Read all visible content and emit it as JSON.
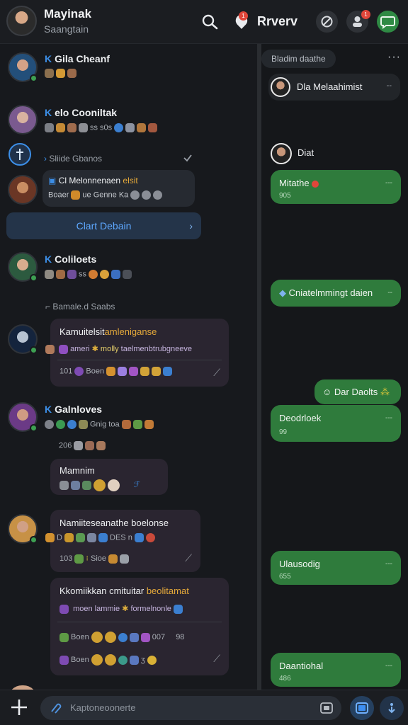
{
  "header": {
    "name": "Mayinak",
    "subtitle": "Saangtain",
    "brand": "Rrverv",
    "pin_badge": "1",
    "notif_badge": "1"
  },
  "chats": [
    {
      "name": "Gila Cheanf",
      "prefix": "K",
      "meta": ""
    },
    {
      "name": "elo Cooniltak",
      "prefix": "K",
      "meta": "ss  s0s"
    },
    {
      "name": "Coliloets",
      "prefix": "K",
      "meta": "ss"
    },
    {
      "name": "Galnloves",
      "prefix": "K",
      "meta": "Gnig  toa"
    }
  ],
  "separators": {
    "first": "Sliide Gbanos",
    "second": "Bamale.d Saabs",
    "count": "206"
  },
  "preview": {
    "title_plain": "Cl Melonnenaen ",
    "title_hl": "elsit",
    "sub_plain": "Boaer",
    "sub_mid": "ue Genne",
    "sub_end": "Ka"
  },
  "cta": {
    "label": "Clart Debain"
  },
  "cards": [
    {
      "title_plain": "Kamuitelsit",
      "title_hl": "amleniganse",
      "line1_a": "ameri",
      "line1_b": "molly",
      "line1_c": "taelmenbtrubgneeve",
      "foot_a": "101",
      "foot_b": "Boen"
    },
    {
      "title_plain": "Mamnim"
    },
    {
      "title_plain": "Namiiteseanathe boelonse",
      "line1_a": "D",
      "line1_b": "DES",
      "line1_c": "n",
      "foot_a": "103",
      "foot_b": "Sioe"
    },
    {
      "title_plain": "Kkomiikkan cmituitar",
      "title_hl": "beolitamat",
      "line1_a": "moen",
      "line1_b": "lammie",
      "line1_c": "formelnonle",
      "foot_a": "Boen",
      "foot_b": "007",
      "foot_c": "98",
      "foot_d": "Boen"
    }
  ],
  "right": {
    "chip": "Bladim daathe",
    "more": "···",
    "top_contact": "Dla Melaahimist",
    "top_contact_tag": "--",
    "second_contact": "Diat",
    "messages": [
      {
        "text": "Mitathe",
        "sub": "905",
        "time": "---"
      },
      {
        "text": "Cniatelmmingt daien",
        "sub": "",
        "time": "--"
      },
      {
        "text": "Dar Daolts",
        "sub": "",
        "time": ""
      },
      {
        "text": "Deodrloek",
        "sub": "99",
        "time": "---"
      },
      {
        "text": "Ulausodig",
        "sub": "655",
        "time": "---"
      },
      {
        "text": "Daantiohal",
        "sub": "486",
        "time": "---"
      }
    ]
  },
  "composer": {
    "placeholder": "Kaptoneoonerte"
  }
}
